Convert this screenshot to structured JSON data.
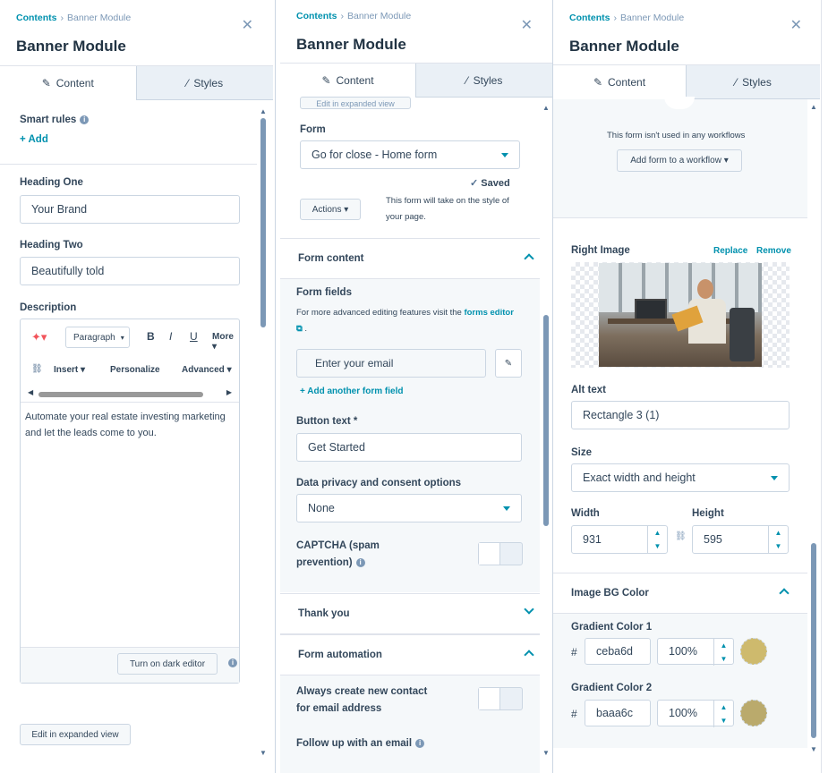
{
  "breadcrumb": {
    "root": "Contents",
    "current": "Banner Module"
  },
  "module_title": "Banner Module",
  "tabs": {
    "content": "Content",
    "styles": "Styles"
  },
  "panel1": {
    "smart_rules": "Smart rules",
    "add": "Add",
    "heading_one_label": "Heading One",
    "heading_one_value": "Your Brand",
    "heading_two_label": "Heading Two",
    "heading_two_value": "Beautifully told",
    "description_label": "Description",
    "toolbar": {
      "paragraph": "Paragraph",
      "bold": "B",
      "italic": "I",
      "underline": "U",
      "more": "More",
      "insert": "Insert",
      "personalize": "Personalize",
      "advanced": "Advanced"
    },
    "editor_text": "Automate your real estate investing marketing and let the leads come to you.",
    "dark_editor": "Turn on dark editor",
    "expanded_view": "Edit in expanded view"
  },
  "panel2": {
    "top_button": "Edit in expanded view",
    "form_label": "Form",
    "form_value": "Go for close - Home form",
    "saved": "Saved",
    "actions": "Actions",
    "style_note": "This form will take on the style of your page.",
    "form_content": "Form content",
    "form_fields": "Form fields",
    "fields_note_prefix": "For more advanced editing features visit the",
    "fields_note_link": "forms editor",
    "email_placeholder": "Enter your email",
    "add_field": "Add another form field",
    "button_text_label": "Button text *",
    "button_text_value": "Get Started",
    "privacy_label": "Data privacy and consent options",
    "privacy_value": "None",
    "captcha_label_1": "CAPTCHA (spam",
    "captcha_label_2": "prevention)",
    "thank_you": "Thank you",
    "automation": "Form automation",
    "always_create_1": "Always create new contact",
    "always_create_2": "for email address",
    "follow_up": "Follow up with an email"
  },
  "panel3": {
    "workflow_note": "This form isn't used in any workflows",
    "add_workflow": "Add form to a workflow",
    "right_image": "Right Image",
    "replace": "Replace",
    "remove": "Remove",
    "alt_label": "Alt text",
    "alt_value": "Rectangle 3 (1)",
    "size_label": "Size",
    "size_value": "Exact width and height",
    "width_label": "Width",
    "width_value": "931",
    "height_label": "Height",
    "height_value": "595",
    "bg_color": "Image BG Color",
    "gradient1": "Gradient Color 1",
    "gradient1_hex": "ceba6d",
    "gradient1_opacity": "100%",
    "gradient2": "Gradient Color 2",
    "gradient2_hex": "baaa6c",
    "gradient2_opacity": "100%"
  },
  "colors": {
    "accent": "#0091ae",
    "swatch1": "#ceba6d",
    "swatch2": "#baaa6c"
  }
}
